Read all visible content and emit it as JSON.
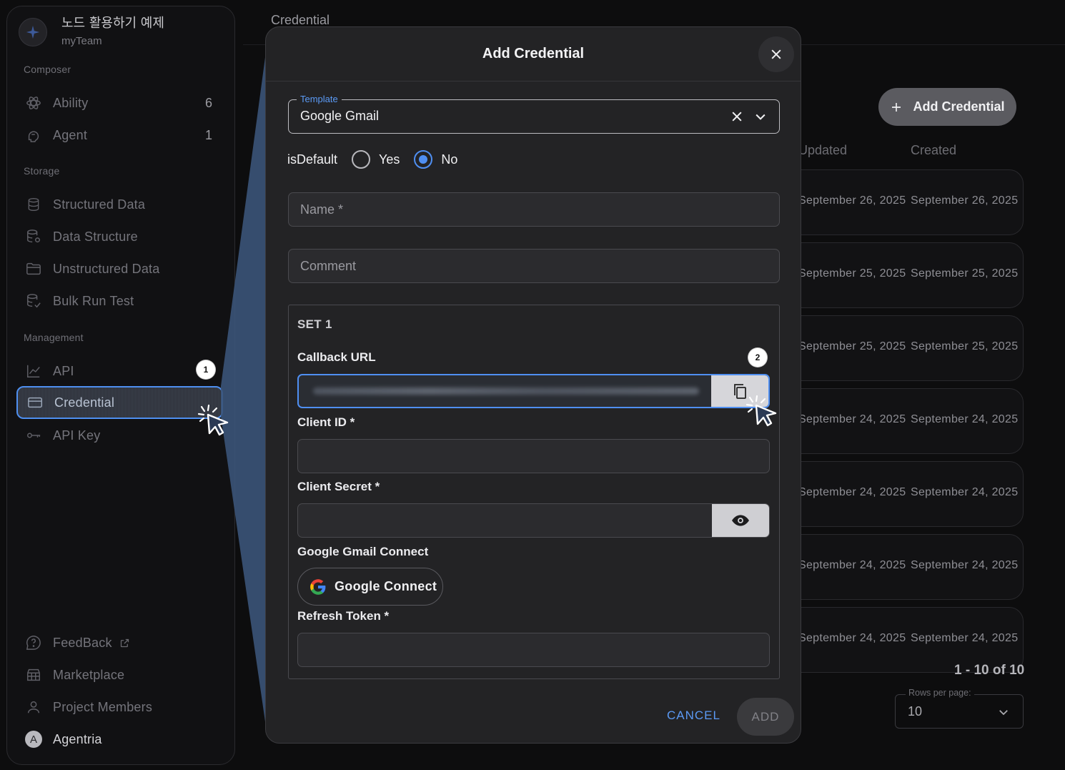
{
  "workspace": {
    "name": "노드 활용하기 예제",
    "team": "myTeam"
  },
  "sidebar": {
    "sections": {
      "composer": "Composer",
      "storage": "Storage",
      "management": "Management"
    },
    "items": [
      {
        "label": "Ability",
        "count": "6",
        "icon": "atom-icon"
      },
      {
        "label": "Agent",
        "count": "1",
        "icon": "agent-icon"
      },
      {
        "label": "Structured Data",
        "icon": "database-icon"
      },
      {
        "label": "Data Structure",
        "icon": "database-settings-icon"
      },
      {
        "label": "Unstructured Data",
        "icon": "folder-icon"
      },
      {
        "label": "Bulk Run Test",
        "icon": "database-test-icon"
      },
      {
        "label": "API",
        "icon": "chart-line-icon"
      },
      {
        "label": "Credential",
        "icon": "card-icon"
      },
      {
        "label": "API Key",
        "icon": "key-icon"
      }
    ],
    "bottom": [
      {
        "label": "FeedBack",
        "icon": "help-circle-icon"
      },
      {
        "label": "Marketplace",
        "icon": "store-icon"
      },
      {
        "label": "Project Members",
        "icon": "person-icon"
      },
      {
        "label": "Agentria",
        "avatar": "A"
      }
    ]
  },
  "steps": {
    "one": "1",
    "two": "2"
  },
  "page": {
    "title": "Credential",
    "add_button": "Add Credential",
    "columns": {
      "updated": "Updated",
      "created": "Created"
    },
    "rows": [
      {
        "updated": "September 26, 2025",
        "created": "September 26, 2025"
      },
      {
        "updated": "September 25, 2025",
        "created": "September 25, 2025"
      },
      {
        "updated": "September 25, 2025",
        "created": "September 25, 2025"
      },
      {
        "updated": "September 24, 2025",
        "created": "September 24, 2025"
      },
      {
        "updated": "September 24, 2025",
        "created": "September 24, 2025"
      },
      {
        "updated": "September 24, 2025",
        "created": "September 24, 2025"
      },
      {
        "updated": "September 24, 2025",
        "created": "September 24, 2025"
      }
    ],
    "pagination": "1 - 10 of 10",
    "rows_per_page_label": "Rows per page:",
    "rows_per_page_value": "10"
  },
  "modal": {
    "title": "Add Credential",
    "template_label": "Template",
    "template_value": "Google Gmail",
    "is_default_label": "isDefault",
    "yes": "Yes",
    "no": "No",
    "selected_default": "No",
    "name_placeholder": "Name *",
    "comment_placeholder": "Comment",
    "set_title": "SET 1",
    "callback_url_label": "Callback URL",
    "client_id_label": "Client ID *",
    "client_secret_label": "Client Secret *",
    "gmail_connect_label": "Google Gmail Connect",
    "google_connect_button": "Google Connect",
    "refresh_token_label": "Refresh Token *",
    "cancel": "CANCEL",
    "add": "ADD"
  },
  "colors": {
    "accent": "#4f8ff2",
    "background": "#0d0d0e",
    "modal": "#232325"
  }
}
